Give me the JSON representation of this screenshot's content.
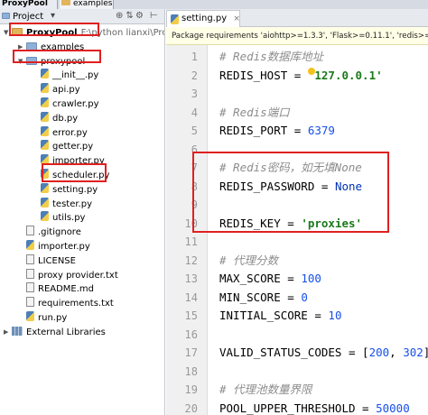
{
  "breadcrumbs": [
    "ProxyPool",
    "examples"
  ],
  "project_panel": {
    "title": "Project",
    "dropdown_glyph": "▾",
    "header_icons": [
      "⊕",
      "⇅",
      "⚙",
      "⊢"
    ],
    "tree": [
      {
        "label": "ProxyPool",
        "suffix": "F:\\python lianxi\\ProxyPool",
        "type": "root-folder",
        "depth": 0,
        "expanded": true
      },
      {
        "label": "examples",
        "type": "folder",
        "depth": 1,
        "expanded": false
      },
      {
        "label": "proxypool",
        "type": "folder",
        "depth": 1,
        "expanded": true
      },
      {
        "label": "__init__.py",
        "type": "py",
        "depth": 2
      },
      {
        "label": "api.py",
        "type": "py",
        "depth": 2
      },
      {
        "label": "crawler.py",
        "type": "py",
        "depth": 2
      },
      {
        "label": "db.py",
        "type": "py",
        "depth": 2
      },
      {
        "label": "error.py",
        "type": "py",
        "depth": 2
      },
      {
        "label": "getter.py",
        "type": "py",
        "depth": 2
      },
      {
        "label": "importer.py",
        "type": "py",
        "depth": 2
      },
      {
        "label": "scheduler.py",
        "type": "py",
        "depth": 2
      },
      {
        "label": "setting.py",
        "type": "py",
        "depth": 2
      },
      {
        "label": "tester.py",
        "type": "py",
        "depth": 2
      },
      {
        "label": "utils.py",
        "type": "py",
        "depth": 2
      },
      {
        "label": ".gitignore",
        "type": "txt",
        "depth": 1
      },
      {
        "label": "importer.py",
        "type": "py",
        "depth": 1
      },
      {
        "label": "LICENSE",
        "type": "txt",
        "depth": 1
      },
      {
        "label": "proxy provider.txt",
        "type": "txt",
        "depth": 1
      },
      {
        "label": "README.md",
        "type": "txt",
        "depth": 1
      },
      {
        "label": "requirements.txt",
        "type": "txt",
        "depth": 1
      },
      {
        "label": "run.py",
        "type": "py",
        "depth": 1
      },
      {
        "label": "External Libraries",
        "type": "lib",
        "depth": 0,
        "expanded": false
      }
    ]
  },
  "editor": {
    "tab_label": "setting.py",
    "tab_close": "×",
    "notice": "Package requirements 'aiohttp>=1.3.3', 'Flask>=0.11.1', 'redis>=2.",
    "lines": [
      {
        "n": "1",
        "parts": [
          {
            "t": "# Redis数据库地址",
            "c": "comment"
          }
        ]
      },
      {
        "n": "2",
        "parts": [
          {
            "t": "REDIS_HOST = ",
            "c": "op"
          },
          {
            "t": "'127.0.0.1'",
            "c": "str"
          }
        ]
      },
      {
        "n": "3",
        "parts": []
      },
      {
        "n": "4",
        "parts": [
          {
            "t": "# Redis端口",
            "c": "comment"
          }
        ]
      },
      {
        "n": "5",
        "parts": [
          {
            "t": "REDIS_PORT = ",
            "c": "op"
          },
          {
            "t": "6379",
            "c": "num"
          }
        ]
      },
      {
        "n": "6",
        "parts": []
      },
      {
        "n": "7",
        "parts": [
          {
            "t": "# Redis密码，如无填None",
            "c": "comment"
          }
        ]
      },
      {
        "n": "8",
        "parts": [
          {
            "t": "REDIS_PASSWORD = ",
            "c": "op"
          },
          {
            "t": "None",
            "c": "kw"
          }
        ]
      },
      {
        "n": "9",
        "parts": []
      },
      {
        "n": "10",
        "parts": [
          {
            "t": "REDIS_KEY = ",
            "c": "op"
          },
          {
            "t": "'proxies'",
            "c": "str"
          }
        ]
      },
      {
        "n": "11",
        "parts": []
      },
      {
        "n": "12",
        "parts": [
          {
            "t": "# 代理分数",
            "c": "comment"
          }
        ]
      },
      {
        "n": "13",
        "parts": [
          {
            "t": "MAX_SCORE = ",
            "c": "op"
          },
          {
            "t": "100",
            "c": "num"
          }
        ]
      },
      {
        "n": "14",
        "parts": [
          {
            "t": "MIN_SCORE = ",
            "c": "op"
          },
          {
            "t": "0",
            "c": "num"
          }
        ]
      },
      {
        "n": "15",
        "parts": [
          {
            "t": "INITIAL_SCORE = ",
            "c": "op"
          },
          {
            "t": "10",
            "c": "num"
          }
        ]
      },
      {
        "n": "16",
        "parts": []
      },
      {
        "n": "17",
        "parts": [
          {
            "t": "VALID_STATUS_CODES = [",
            "c": "op"
          },
          {
            "t": "200",
            "c": "num"
          },
          {
            "t": ", ",
            "c": "op"
          },
          {
            "t": "302",
            "c": "num"
          },
          {
            "t": "]",
            "c": "op"
          }
        ]
      },
      {
        "n": "18",
        "parts": []
      },
      {
        "n": "19",
        "parts": [
          {
            "t": "# 代理池数量界限",
            "c": "comment"
          }
        ]
      },
      {
        "n": "20",
        "parts": [
          {
            "t": "POOL_UPPER_THRESHOLD = ",
            "c": "op"
          },
          {
            "t": "50000",
            "c": "num"
          }
        ]
      }
    ]
  },
  "colors": {
    "highlight_box": "#e02020",
    "notice_bg": "#fffee6"
  }
}
